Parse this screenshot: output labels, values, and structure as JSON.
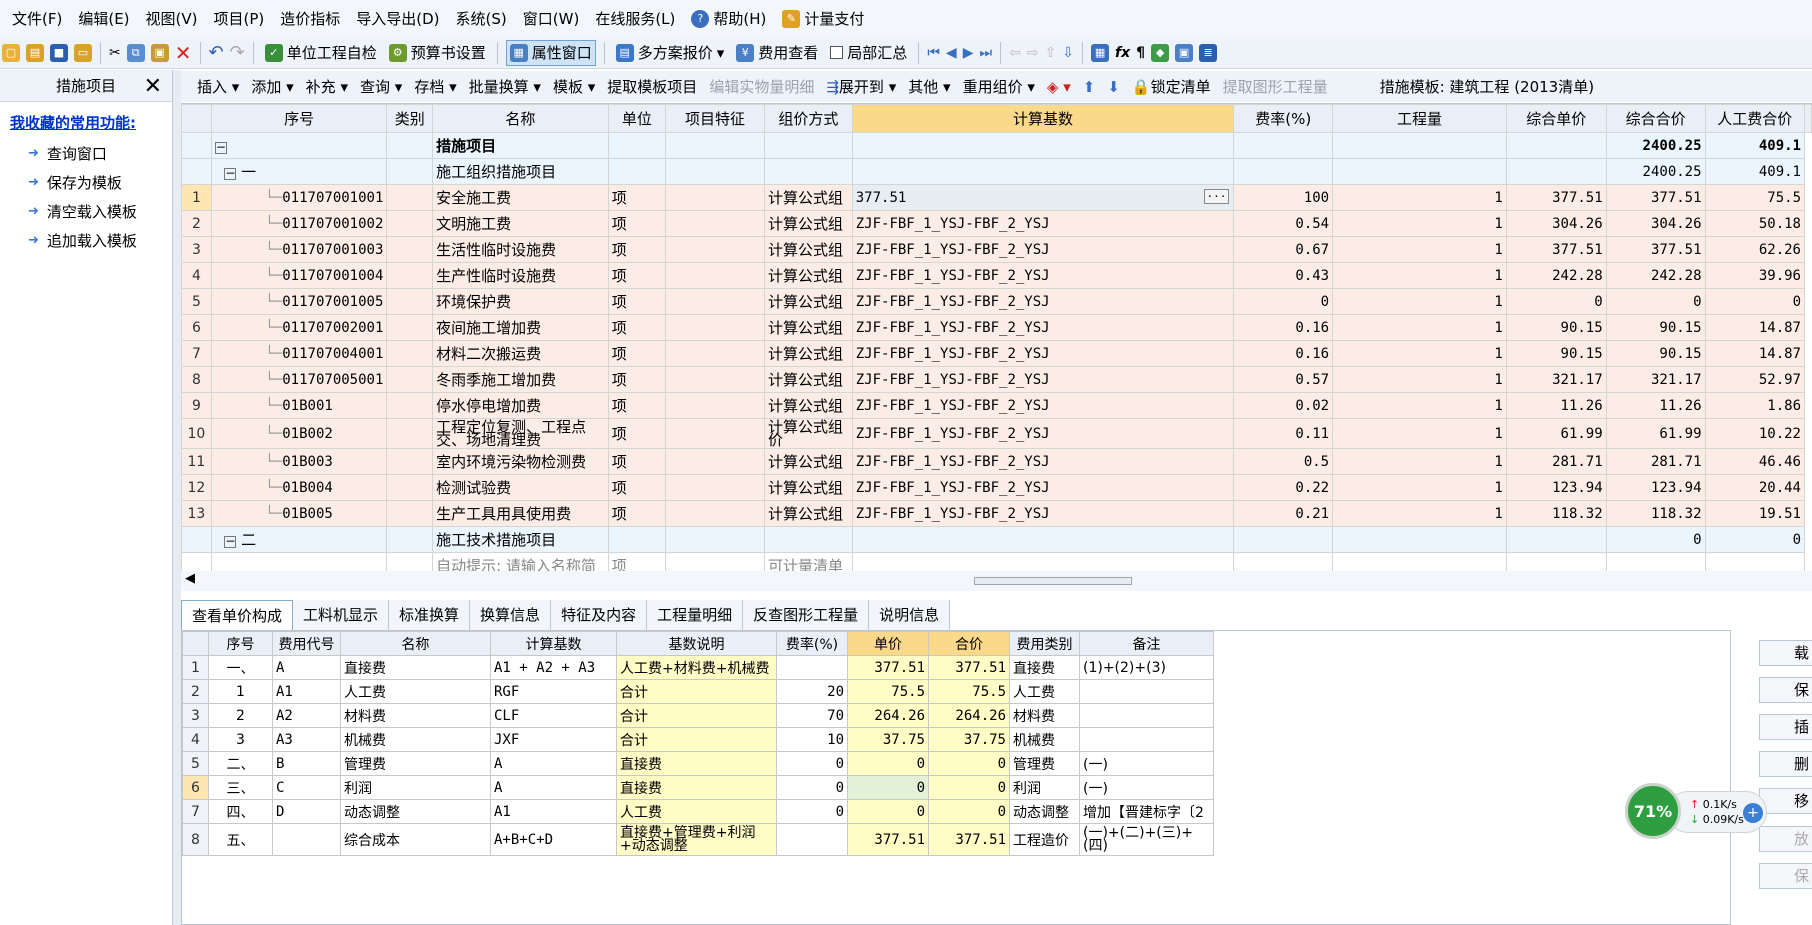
{
  "menu": [
    "文件(F)",
    "编辑(E)",
    "视图(V)",
    "项目(P)",
    "造价指标",
    "导入导出(D)",
    "系统(S)",
    "窗口(W)",
    "在线服务(L)",
    "帮助(H)",
    "计量支付"
  ],
  "toolbar1": {
    "unit_check": "单位工程自检",
    "budget_settings": "预算书设置",
    "property_window": "属性窗口",
    "multi_quote": "多方案报价",
    "fee_view": "费用查看",
    "partial_summary": "局部汇总"
  },
  "side": {
    "title": "措施项目",
    "favorites": "我收藏的常用功能:",
    "links": [
      "查询窗口",
      "保存为模板",
      "清空载入模板",
      "追加载入模板"
    ]
  },
  "toolbar2": {
    "insert": "插入",
    "add": "添加",
    "supplement": "补充",
    "query": "查询",
    "archive": "存档",
    "batch": "批量换算",
    "template": "模板",
    "extract_template": "提取模板项目",
    "edit_detail": "编辑实物量明细",
    "expand_to": "展开到",
    "other": "其他",
    "reuse": "重用组价",
    "lock": "锁定清单",
    "extract_graphic": "提取图形工程量",
    "template_label": "措施模板: 建筑工程 (2013清单)"
  },
  "main": {
    "headers": [
      "序号",
      "类别",
      "名称",
      "单位",
      "项目特征",
      "组价方式",
      "计算基数",
      "费率(%)",
      "工程量",
      "综合单价",
      "综合合价",
      "人工费合价"
    ],
    "top": {
      "name": "措施项目",
      "total": "2400.25",
      "labor": "409.1"
    },
    "group1": {
      "num": "一",
      "name": "施工组织措施项目",
      "total": "2400.25",
      "labor": "409.1"
    },
    "rows": [
      {
        "n": "1",
        "code": "011707001001",
        "name": "安全施工费",
        "unit": "项",
        "method": "计算公式组",
        "base": "377.51",
        "rate": "100",
        "qty": "1",
        "price": "377.51",
        "total": "377.51",
        "labor": "75.5"
      },
      {
        "n": "2",
        "code": "011707001002",
        "name": "文明施工费",
        "unit": "项",
        "method": "计算公式组",
        "base": "ZJF-FBF_1_YSJ-FBF_2_YSJ",
        "rate": "0.54",
        "qty": "1",
        "price": "304.26",
        "total": "304.26",
        "labor": "50.18"
      },
      {
        "n": "3",
        "code": "011707001003",
        "name": "生活性临时设施费",
        "unit": "项",
        "method": "计算公式组",
        "base": "ZJF-FBF_1_YSJ-FBF_2_YSJ",
        "rate": "0.67",
        "qty": "1",
        "price": "377.51",
        "total": "377.51",
        "labor": "62.26"
      },
      {
        "n": "4",
        "code": "011707001004",
        "name": "生产性临时设施费",
        "unit": "项",
        "method": "计算公式组",
        "base": "ZJF-FBF_1_YSJ-FBF_2_YSJ",
        "rate": "0.43",
        "qty": "1",
        "price": "242.28",
        "total": "242.28",
        "labor": "39.96"
      },
      {
        "n": "5",
        "code": "011707001005",
        "name": "环境保护费",
        "unit": "项",
        "method": "计算公式组",
        "base": "ZJF-FBF_1_YSJ-FBF_2_YSJ",
        "rate": "0",
        "qty": "1",
        "price": "0",
        "total": "0",
        "labor": "0"
      },
      {
        "n": "6",
        "code": "011707002001",
        "name": "夜间施工增加费",
        "unit": "项",
        "method": "计算公式组",
        "base": "ZJF-FBF_1_YSJ-FBF_2_YSJ",
        "rate": "0.16",
        "qty": "1",
        "price": "90.15",
        "total": "90.15",
        "labor": "14.87"
      },
      {
        "n": "7",
        "code": "011707004001",
        "name": "材料二次搬运费",
        "unit": "项",
        "method": "计算公式组",
        "base": "ZJF-FBF_1_YSJ-FBF_2_YSJ",
        "rate": "0.16",
        "qty": "1",
        "price": "90.15",
        "total": "90.15",
        "labor": "14.87"
      },
      {
        "n": "8",
        "code": "011707005001",
        "name": "冬雨季施工增加费",
        "unit": "项",
        "method": "计算公式组",
        "base": "ZJF-FBF_1_YSJ-FBF_2_YSJ",
        "rate": "0.57",
        "qty": "1",
        "price": "321.17",
        "total": "321.17",
        "labor": "52.97"
      },
      {
        "n": "9",
        "code": "01B001",
        "name": "停水停电增加费",
        "unit": "项",
        "method": "计算公式组",
        "base": "ZJF-FBF_1_YSJ-FBF_2_YSJ",
        "rate": "0.02",
        "qty": "1",
        "price": "11.26",
        "total": "11.26",
        "labor": "1.86"
      },
      {
        "n": "10",
        "code": "01B002",
        "name": "工程定位复测、工程点交、场地清理费",
        "unit": "项",
        "method": "计算公式组价",
        "base": "ZJF-FBF_1_YSJ-FBF_2_YSJ",
        "rate": "0.11",
        "qty": "1",
        "price": "61.99",
        "total": "61.99",
        "labor": "10.22"
      },
      {
        "n": "11",
        "code": "01B003",
        "name": "室内环境污染物检测费",
        "unit": "项",
        "method": "计算公式组",
        "base": "ZJF-FBF_1_YSJ-FBF_2_YSJ",
        "rate": "0.5",
        "qty": "1",
        "price": "281.71",
        "total": "281.71",
        "labor": "46.46"
      },
      {
        "n": "12",
        "code": "01B004",
        "name": "检测试验费",
        "unit": "项",
        "method": "计算公式组",
        "base": "ZJF-FBF_1_YSJ-FBF_2_YSJ",
        "rate": "0.22",
        "qty": "1",
        "price": "123.94",
        "total": "123.94",
        "labor": "20.44"
      },
      {
        "n": "13",
        "code": "01B005",
        "name": "生产工具用具使用费",
        "unit": "项",
        "method": "计算公式组",
        "base": "ZJF-FBF_1_YSJ-FBF_2_YSJ",
        "rate": "0.21",
        "qty": "1",
        "price": "118.32",
        "total": "118.32",
        "labor": "19.51"
      }
    ],
    "group2": {
      "num": "二",
      "name": "施工技术措施项目",
      "total": "0",
      "labor": "0"
    },
    "hint": {
      "name": "自动提示: 请输入名称简",
      "unit": "项",
      "method": "可计量清单"
    }
  },
  "tabs": [
    "查看单价构成",
    "工料机显示",
    "标准换算",
    "换算信息",
    "特征及内容",
    "工程量明细",
    "反查图形工程量",
    "说明信息"
  ],
  "lower": {
    "headers": [
      "序号",
      "费用代号",
      "名称",
      "计算基数",
      "基数说明",
      "费率(%)",
      "单价",
      "合价",
      "费用类别",
      "备注"
    ],
    "rows": [
      {
        "idx": "1",
        "seq": "一、",
        "code": "A",
        "name": "直接费",
        "base": "A1 + A2 + A3",
        "desc": "人工费+材料费+机械费",
        "rate": "",
        "price": "377.51",
        "total": "377.51",
        "type": "直接费",
        "note": "(1)+(2)+(3)"
      },
      {
        "idx": "2",
        "seq": "1",
        "code": "A1",
        "name": "人工费",
        "base": "RGF",
        "desc": "合计",
        "rate": "20",
        "price": "75.5",
        "total": "75.5",
        "type": "人工费",
        "note": ""
      },
      {
        "idx": "3",
        "seq": "2",
        "code": "A2",
        "name": "材料费",
        "base": "CLF",
        "desc": "合计",
        "rate": "70",
        "price": "264.26",
        "total": "264.26",
        "type": "材料费",
        "note": ""
      },
      {
        "idx": "4",
        "seq": "3",
        "code": "A3",
        "name": "机械费",
        "base": "JXF",
        "desc": "合计",
        "rate": "10",
        "price": "37.75",
        "total": "37.75",
        "type": "机械费",
        "note": ""
      },
      {
        "idx": "5",
        "seq": "二、",
        "code": "B",
        "name": "管理费",
        "base": "A",
        "desc": "直接费",
        "rate": "0",
        "price": "0",
        "total": "0",
        "type": "管理费",
        "note": "(一)"
      },
      {
        "idx": "6",
        "seq": "三、",
        "code": "C",
        "name": "利润",
        "base": "A",
        "desc": "直接费",
        "rate": "0",
        "price": "0",
        "total": "0",
        "type": "利润",
        "note": "(一)"
      },
      {
        "idx": "7",
        "seq": "四、",
        "code": "D",
        "name": "动态调整",
        "base": "A1",
        "desc": "人工费",
        "rate": "0",
        "price": "0",
        "total": "0",
        "type": "动态调整",
        "note": "增加【晋建标字〔2"
      },
      {
        "idx": "8",
        "seq": "五、",
        "code": "",
        "name": "综合成本",
        "base": "A+B+C+D",
        "desc": "直接费+管理费+利润+动态调整",
        "rate": "",
        "price": "377.51",
        "total": "377.51",
        "type": "工程造价",
        "note": "(一)+(二)+(三)+(四)"
      }
    ]
  },
  "right_buttons": [
    "载入",
    "保存",
    "插",
    "删",
    "移",
    "放弃",
    "保存"
  ],
  "network": {
    "percent": "71%",
    "up": "0.1K/s",
    "down": "0.09K/s"
  }
}
